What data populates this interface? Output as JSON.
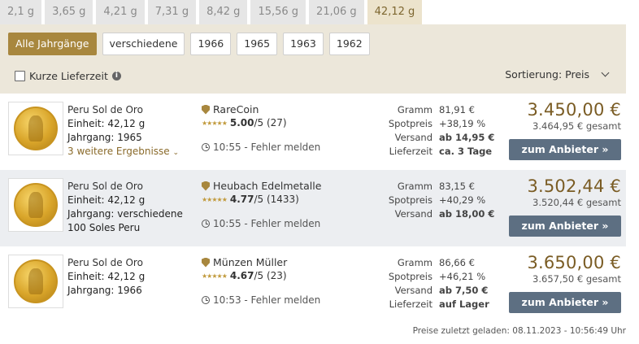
{
  "weights": [
    "2,1 g",
    "3,65 g",
    "4,21 g",
    "7,31 g",
    "8,42 g",
    "15,56 g",
    "21,06 g",
    "42,12 g"
  ],
  "active_weight": "42,12 g",
  "years": [
    "Alle Jahrgänge",
    "verschiedene",
    "1966",
    "1965",
    "1963",
    "1962"
  ],
  "filter": {
    "fast_delivery": "Kurze Lieferzeit",
    "sort": "Sortierung: Preis"
  },
  "cta_label": "zum Anbieter »",
  "offers": [
    {
      "product": "Peru Sol de Oro",
      "unit": "Einheit: 42,12 g",
      "year": "Jahrgang: 1965",
      "extra": "",
      "more": "3 weitere Ergebnisse",
      "dealer": "RareCoin",
      "rating": "5.00",
      "rating_suffix": "/5 (27)",
      "time": "10:55 - Fehler melden",
      "specs": [
        {
          "k": "Gramm",
          "v": "81,91 €",
          "bold": false
        },
        {
          "k": "Spotpreis",
          "v": "+38,19 %",
          "bold": false
        },
        {
          "k": "Versand",
          "v": "ab 14,95 €",
          "bold": true
        },
        {
          "k": "Lieferzeit",
          "v": "ca. 3 Tage",
          "bold": true
        }
      ],
      "price": "3.450,00 €",
      "total": "3.464,95 € gesamt"
    },
    {
      "product": "Peru Sol de Oro",
      "unit": "Einheit: 42,12 g",
      "year": "Jahrgang: verschiedene",
      "extra": "100 Soles Peru",
      "more": "",
      "dealer": "Heubach Edelmetalle",
      "rating": "4.77",
      "rating_suffix": "/5 (1433)",
      "time": "10:55 - Fehler melden",
      "specs": [
        {
          "k": "Gramm",
          "v": "83,15 €",
          "bold": false
        },
        {
          "k": "Spotpreis",
          "v": "+40,29 %",
          "bold": false
        },
        {
          "k": "Versand",
          "v": "ab 18,00 €",
          "bold": true
        }
      ],
      "price": "3.502,44 €",
      "total": "3.520,44 € gesamt"
    },
    {
      "product": "Peru Sol de Oro",
      "unit": "Einheit: 42,12 g",
      "year": "Jahrgang: 1966",
      "extra": "",
      "more": "",
      "dealer": "Münzen Müller",
      "rating": "4.67",
      "rating_suffix": "/5 (23)",
      "time": "10:53 - Fehler melden",
      "specs": [
        {
          "k": "Gramm",
          "v": "86,66 €",
          "bold": false
        },
        {
          "k": "Spotpreis",
          "v": "+46,21 %",
          "bold": false
        },
        {
          "k": "Versand",
          "v": "ab 7,50 €",
          "bold": true
        },
        {
          "k": "Lieferzeit",
          "v": "auf Lager",
          "bold": true
        }
      ],
      "price": "3.650,00 €",
      "total": "3.657,50 € gesamt"
    }
  ],
  "footer": "Preise zuletzt geladen: 08.11.2023 - 10:56:49 Uhr"
}
